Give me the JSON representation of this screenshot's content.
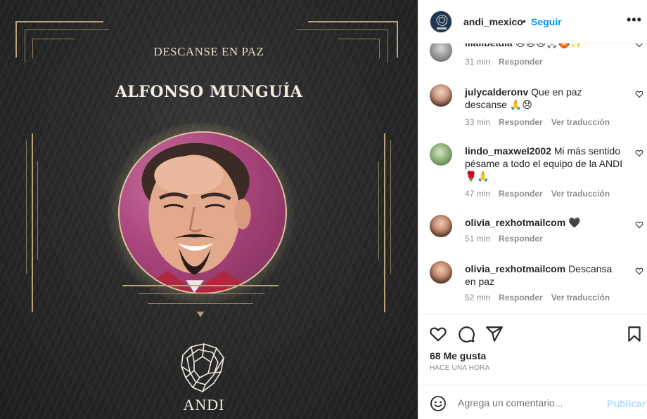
{
  "post_image": {
    "subtitle": "DESCANSE EN PAZ",
    "name": "ALFONSO MUNGUÍA",
    "logo_text": "ANDI",
    "accent_color": "#b8a27a"
  },
  "header": {
    "username": "andi_mexico",
    "separator": "•",
    "follow_label": "Seguir",
    "more_icon": "more-options-icon",
    "more_glyph": "•••"
  },
  "comments": [
    {
      "username": "lilalibeldia",
      "text": "😞😞😞🙏🏻🏵️✨",
      "time": "31 min",
      "reply": "Responder",
      "translate": ""
    },
    {
      "username": "julycalderonv",
      "text": "Que en paz descanse 🙏😞",
      "time": "33 min",
      "reply": "Responder",
      "translate": "Ver traducción"
    },
    {
      "username": "lindo_maxwel2002",
      "text": "Mi más sentido pésame a todo el equipo de la ANDI 🌹🙏",
      "time": "47 min",
      "reply": "Responder",
      "translate": "Ver traducción"
    },
    {
      "username": "olivia_rexhotmailcom",
      "text": "🖤",
      "time": "51 min",
      "reply": "Responder",
      "translate": ""
    },
    {
      "username": "olivia_rexhotmailcom",
      "text": "Descansa en paz",
      "time": "52 min",
      "reply": "Responder",
      "translate": "Ver traducción"
    }
  ],
  "actions": {
    "likes": "68 Me gusta",
    "time_ago": "HACE UNA HORA"
  },
  "comment_box": {
    "placeholder": "Agrega un comentario...",
    "publish_label": "Publicar"
  },
  "colors": {
    "link": "#0095f6",
    "publish_disabled": "#b2dffc",
    "muted": "#8e8e8e"
  }
}
